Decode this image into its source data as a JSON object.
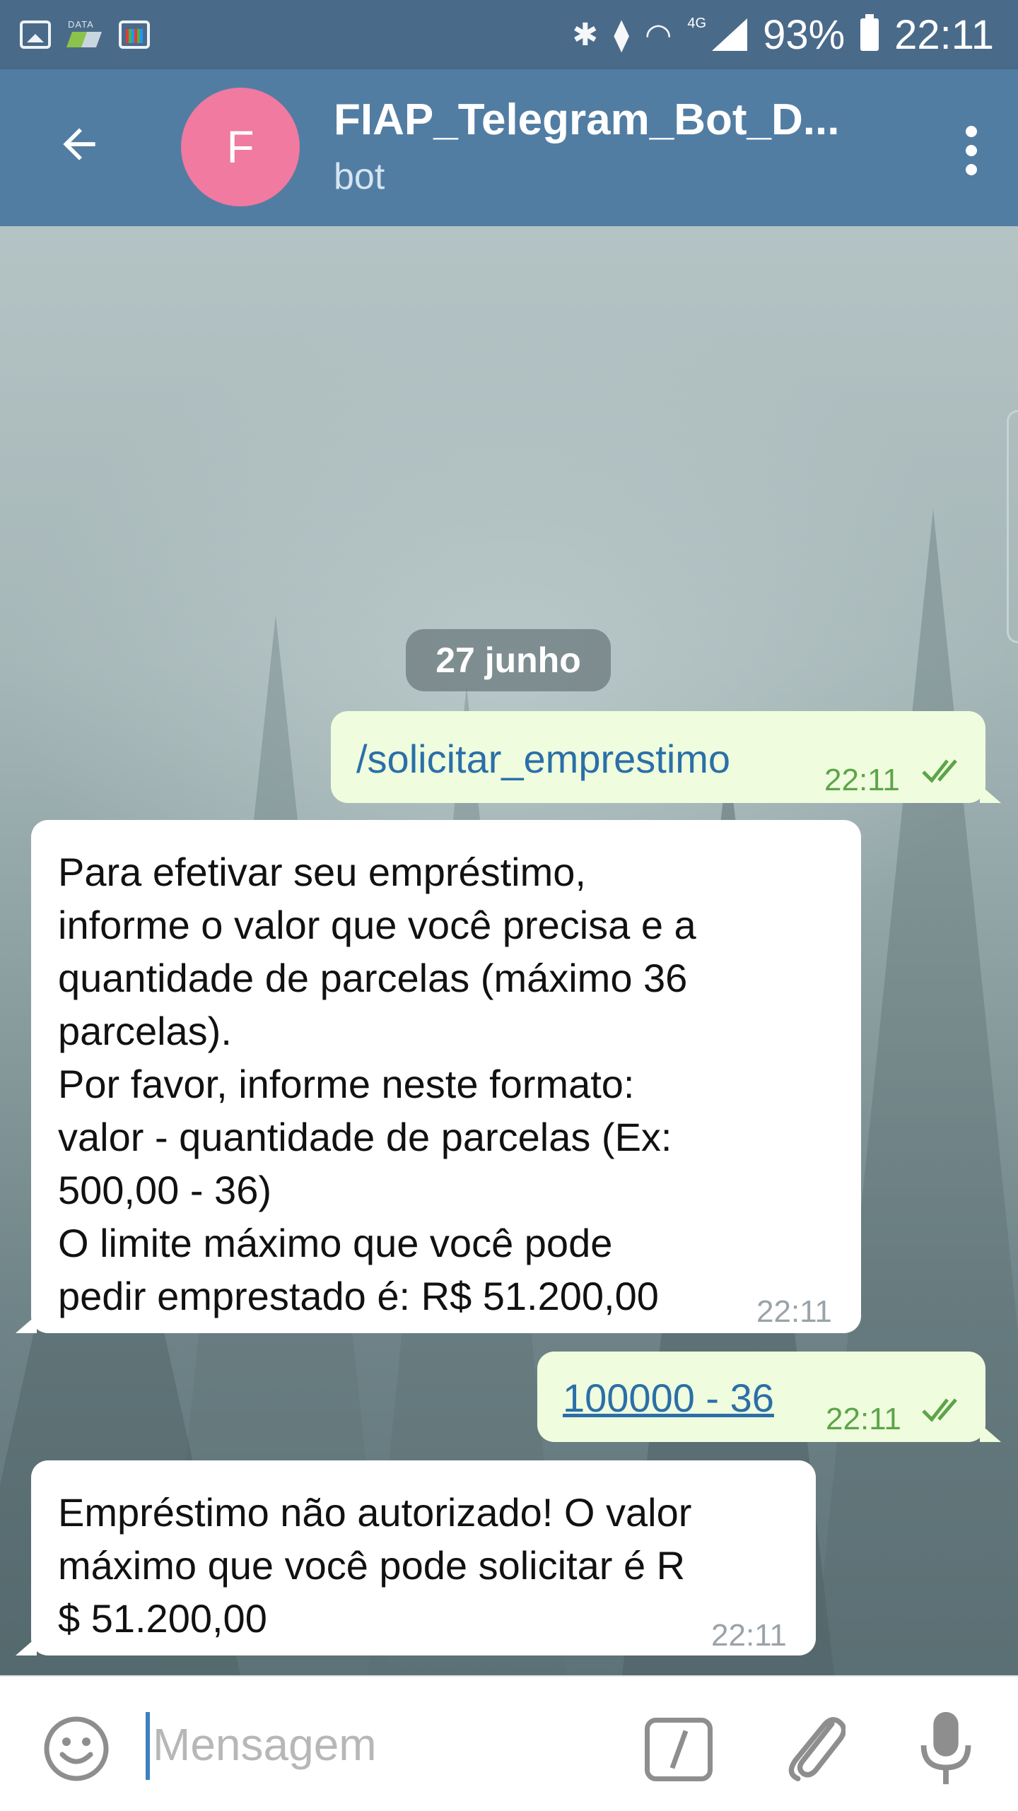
{
  "status_bar": {
    "battery": "93%",
    "time": "22:11",
    "network": "4G",
    "data_label": "DATA"
  },
  "app_bar": {
    "title": "FIAP_Telegram_Bot_D...",
    "subtitle": "bot",
    "avatar_letter": "F"
  },
  "chat": {
    "date": "27 junho",
    "messages": [
      {
        "direction": "out",
        "text": "/solicitar_emprestimo",
        "time": "22:11"
      },
      {
        "direction": "in",
        "lines": [
          "Para efetivar seu empréstimo,",
          "informe o valor que você precisa e a",
          "quantidade de parcelas (máximo 36",
          "parcelas).",
          "Por favor, informe neste formato:",
          "valor - quantidade de parcelas (Ex:",
          "500,00 - 36)",
          "O limite máximo que você pode",
          "pedir emprestado é: R$ 51.200,00"
        ],
        "time": "22:11"
      },
      {
        "direction": "out",
        "text": "100000 - 36",
        "time": "22:11"
      },
      {
        "direction": "in",
        "lines": [
          "Empréstimo não autorizado! O valor",
          "máximo que você pode solicitar é R",
          "$ 51.200,00"
        ],
        "time": "22:11"
      }
    ]
  },
  "input_bar": {
    "placeholder": "Mensagem"
  },
  "colors": {
    "header": "#527da3",
    "status_bar": "#4a6a8a",
    "avatar": "#f07aa0",
    "outgoing_bubble": "#effdde",
    "incoming_bubble": "#ffffff",
    "read_ticks": "#5da449",
    "command_link": "#2b6fa8"
  },
  "icons": [
    "back-arrow-icon",
    "more-vert-icon",
    "emoji-icon",
    "bot-command-icon",
    "attach-icon",
    "mic-icon",
    "double-check-icon"
  ]
}
